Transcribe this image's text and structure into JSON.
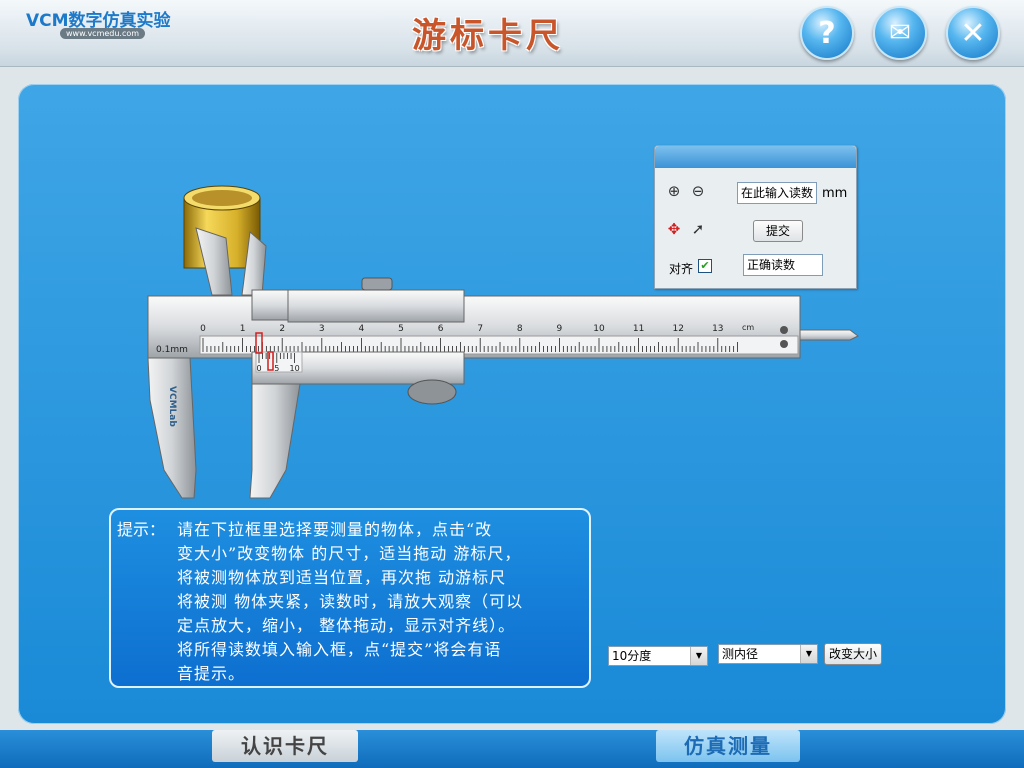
{
  "header": {
    "logo_text": "VCM数字仿真实验",
    "logo_url": "www.vcmedu.com",
    "title": "游标卡尺",
    "buttons": {
      "help": "?",
      "mail": "✉",
      "close": "✕"
    }
  },
  "reading_panel": {
    "input_placeholder": "在此输入读数",
    "unit": "mm",
    "submit_label": "提交",
    "align_label": "对齐",
    "align_checked": true,
    "correct_reading_label": "正确读数",
    "icons": [
      "zoom-in-icon",
      "zoom-out-icon",
      "fixed-point-icon",
      "pointer-icon"
    ]
  },
  "caliper": {
    "scale_numbers": [
      "0",
      "1",
      "2",
      "3",
      "4",
      "5",
      "6",
      "7",
      "8",
      "9",
      "10",
      "11",
      "12",
      "13"
    ],
    "unit_label": "cm",
    "precision_label": "0.1mm",
    "vernier_numbers": [
      "0",
      "5",
      "10"
    ],
    "brand": "VCMLab"
  },
  "hint": {
    "label": "提示：",
    "lines": [
      "请在下拉框里选择要测量的物体，点击“改",
      "变大小”改变物体 的尺寸，适当拖动 游标尺，",
      "将被测物体放到适当位置，再次拖 动游标尺",
      "将被测 物体夹紧，读数时，请放大观察（可以",
      "定点放大，缩小， 整体拖动，显示对齐线）。",
      "将所得读数填入输入框，点“提交”将会有语",
      "音提示。"
    ]
  },
  "controls": {
    "precision_select": "10分度",
    "object_select": "测内径",
    "change_size_label": "改变大小"
  },
  "footer": {
    "learn_label": "认识卡尺",
    "simulate_label": "仿真测量"
  },
  "colors": {
    "panel_blue": "#1a8ad7",
    "title_orange": "#c9552b",
    "marker_red": "#d21f1f",
    "gold_object": "#d6b02a"
  }
}
